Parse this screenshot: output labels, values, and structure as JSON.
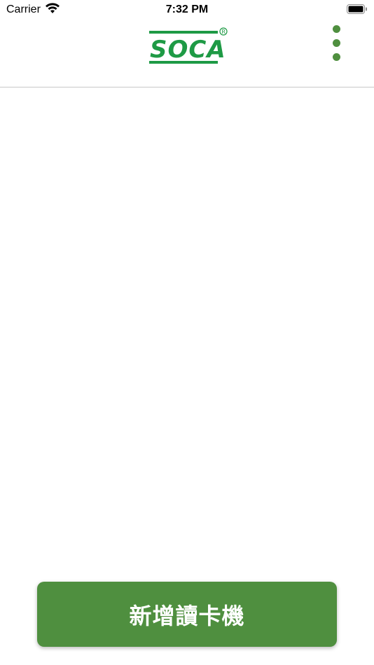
{
  "status_bar": {
    "carrier": "Carrier",
    "time": "7:32 PM",
    "wifi_icon": "wifi-icon",
    "battery_icon": "battery-icon"
  },
  "header": {
    "logo_text": "SOCA",
    "logo_mark": "®",
    "logo_color": "#1e9a45",
    "menu_icon": "more-vertical-icon",
    "accent": "#4f8f3f"
  },
  "actions": {
    "add_reader_label": "新增讀卡機"
  },
  "colors": {
    "primary": "#4f8f3f",
    "divider": "#c8c8c8",
    "background": "#ffffff"
  }
}
